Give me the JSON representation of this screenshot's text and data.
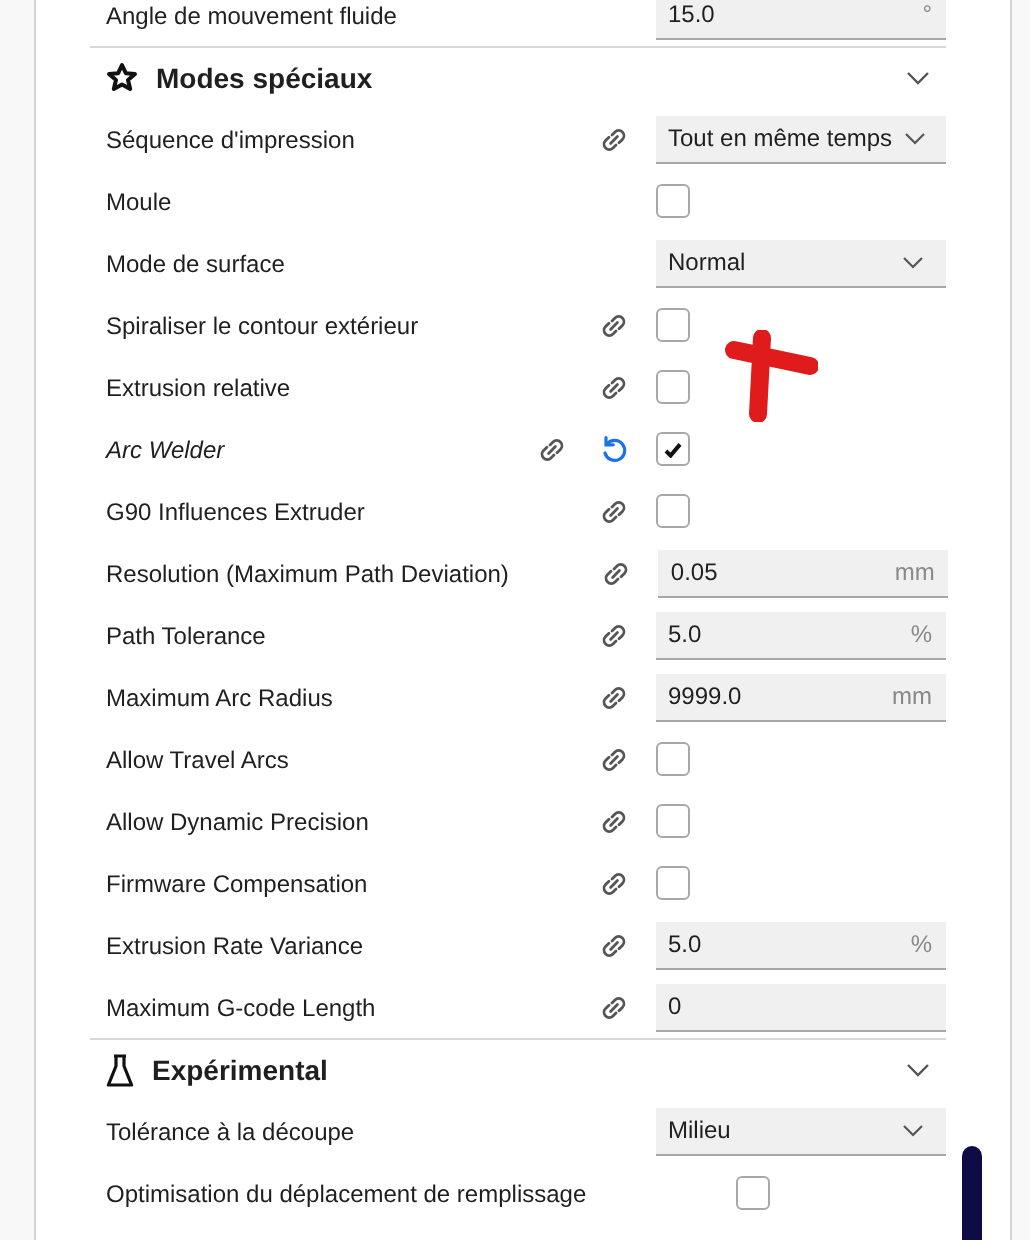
{
  "sections": [
    {
      "rows": [
        {
          "kind": "number",
          "label": "Angle de mouvement fluide",
          "italic": false,
          "linked": false,
          "reset": false,
          "value": "15.0",
          "unit": "°"
        }
      ]
    },
    {
      "title": "Modes spéciaux",
      "expanded": true,
      "rows": [
        {
          "kind": "dropdown",
          "label": "Séquence d'impression",
          "italic": false,
          "linked": true,
          "reset": false,
          "value": "Tout en même temps",
          "compact": true
        },
        {
          "kind": "checkbox",
          "label": "Moule",
          "italic": false,
          "linked": false,
          "reset": false,
          "checked": false
        },
        {
          "kind": "dropdown",
          "label": "Mode de surface",
          "italic": false,
          "linked": false,
          "reset": false,
          "value": "Normal",
          "compact": false
        },
        {
          "kind": "checkbox",
          "label": "Spiraliser le contour extérieur",
          "italic": false,
          "linked": true,
          "reset": false,
          "checked": false
        },
        {
          "kind": "checkbox",
          "label": "Extrusion relative",
          "italic": false,
          "linked": true,
          "reset": false,
          "checked": false
        },
        {
          "kind": "checkbox",
          "label": "Arc Welder",
          "italic": true,
          "linked": true,
          "reset": true,
          "checked": true
        },
        {
          "kind": "checkbox",
          "label": "G90 Influences Extruder",
          "italic": false,
          "linked": true,
          "reset": false,
          "checked": false
        },
        {
          "kind": "number",
          "label": "Resolution (Maximum Path Deviation)",
          "italic": false,
          "linked": true,
          "reset": false,
          "value": "0.05",
          "unit": "mm"
        },
        {
          "kind": "number",
          "label": "Path Tolerance",
          "italic": false,
          "linked": true,
          "reset": false,
          "value": "5.0",
          "unit": "%"
        },
        {
          "kind": "number",
          "label": "Maximum Arc Radius",
          "italic": false,
          "linked": true,
          "reset": false,
          "value": "9999.0",
          "unit": "mm"
        },
        {
          "kind": "checkbox",
          "label": "Allow Travel Arcs",
          "italic": false,
          "linked": true,
          "reset": false,
          "checked": false
        },
        {
          "kind": "checkbox",
          "label": "Allow Dynamic Precision",
          "italic": false,
          "linked": true,
          "reset": false,
          "checked": false
        },
        {
          "kind": "checkbox",
          "label": "Firmware Compensation",
          "italic": false,
          "linked": true,
          "reset": false,
          "checked": false
        },
        {
          "kind": "number",
          "label": "Extrusion Rate Variance",
          "italic": false,
          "linked": true,
          "reset": false,
          "value": "5.0",
          "unit": "%"
        },
        {
          "kind": "number",
          "label": "Maximum G-code Length",
          "italic": false,
          "linked": true,
          "reset": false,
          "value": "0"
        }
      ]
    },
    {
      "title": "Expérimental",
      "expanded": true,
      "rows": [
        {
          "kind": "dropdown",
          "label": "Tolérance à la découpe",
          "italic": false,
          "linked": false,
          "reset": false,
          "value": "Milieu",
          "compact": false
        },
        {
          "kind": "checkbox",
          "label": "Optimisation du déplacement de remplissage",
          "italic": false,
          "linked": false,
          "reset": false,
          "checked": false
        }
      ]
    }
  ]
}
